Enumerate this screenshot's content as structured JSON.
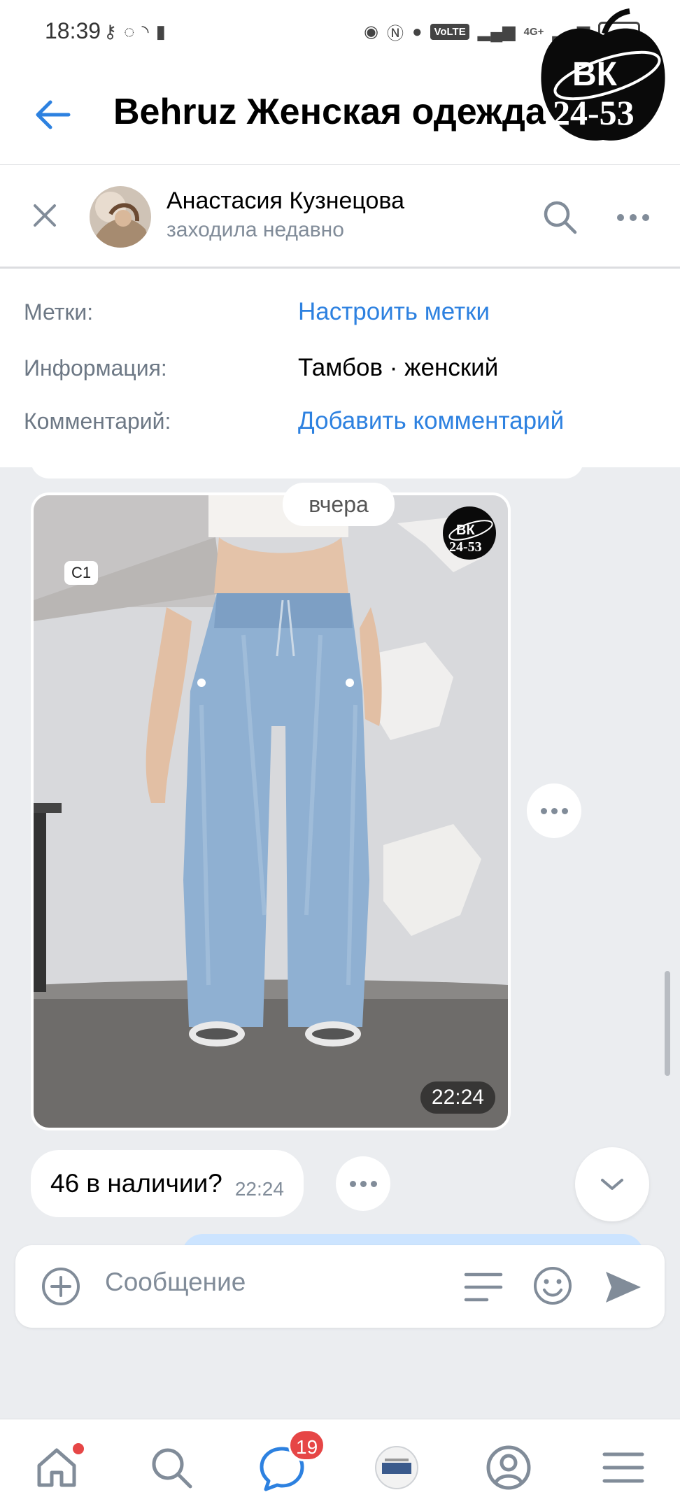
{
  "status_bar": {
    "time": "18:39",
    "volte": "VoLTE",
    "network": "4G+"
  },
  "header": {
    "title": "Behruz Женская одежда"
  },
  "watermark": {
    "line1": "ВК",
    "line2": "24-53"
  },
  "profile": {
    "name": "Анастасия Кузнецова",
    "status": "заходила недавно"
  },
  "info": {
    "tags_label": "Метки:",
    "tags_action": "Настроить метки",
    "info_label": "Информация:",
    "info_value": "Тамбов · женский",
    "comment_label": "Комментарий:",
    "comment_action": "Добавить комментарий"
  },
  "chat": {
    "date_separator": "вчера",
    "photo_message": {
      "badge": "C1",
      "logo_line1": "ВК",
      "logo_line2": "24-53",
      "time": "22:24"
    },
    "text_message": {
      "text": "46 в наличии?",
      "time": "22:24"
    }
  },
  "composer": {
    "placeholder": "Сообщение"
  },
  "bottom_nav": {
    "messages_count": "19"
  },
  "colors": {
    "accent": "#2d81e0",
    "background": "#ebedf0",
    "badge": "#e64646",
    "secondary_text": "#818c99"
  }
}
